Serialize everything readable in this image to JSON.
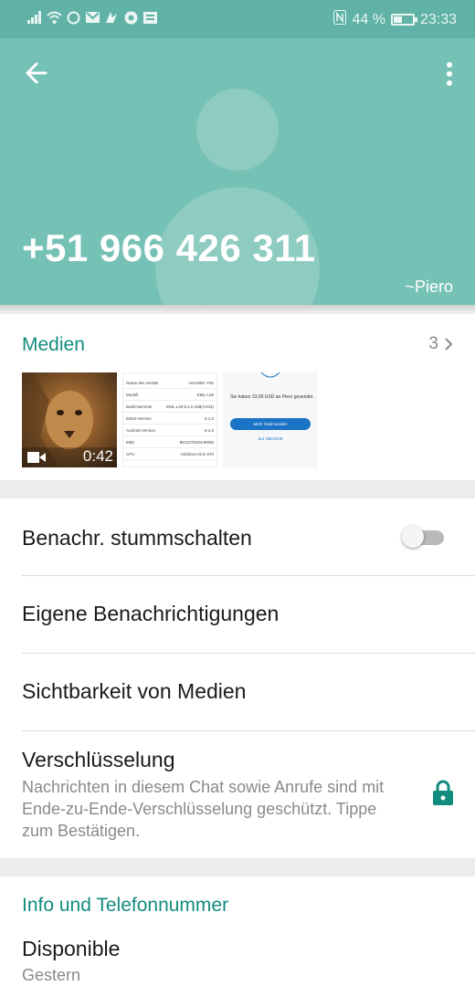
{
  "status_bar": {
    "battery_percent": "44 %",
    "battery_level": 0.44,
    "time": "23:33",
    "icons": [
      "signal-icon",
      "wifi-icon",
      "whatsapp-icon",
      "gmail-icon",
      "messenger-icon",
      "chrome-icon",
      "news-icon",
      "nfc-icon",
      "battery-icon"
    ]
  },
  "header": {
    "phone": "+51 966 426 311",
    "nickname": "~Piero",
    "background_color": "#76c1b6"
  },
  "media": {
    "title": "Medien",
    "count": "3",
    "video_duration": "0:42",
    "spec_rows": [
      {
        "k": "Name des Geräts",
        "v": "HUAWEI Y9S"
      },
      {
        "k": "Modell",
        "v": "EML-L29"
      },
      {
        "k": "Build-Nummer",
        "v": "EML-L29 8.1.0.168(C432)"
      },
      {
        "k": "EMUI-Version",
        "v": "8.1.0"
      },
      {
        "k": "Android-Version",
        "v": "8.1.0"
      },
      {
        "k": "IMEI",
        "v": "861107040449095"
      },
      {
        "k": "CPU",
        "v": "HiSilicon Kirin 970"
      }
    ],
    "payment": {
      "text": "Sie haben 33,00 USD an Piero gesendet.",
      "button": "Mehr Geld senden",
      "link": "Zur Übersicht"
    }
  },
  "settings": {
    "mute_label": "Benachr. stummschalten",
    "mute_on": false,
    "custom_notifications_label": "Eigene Benachrichtigungen",
    "media_visibility_label": "Sichtbarkeit von Medien",
    "encryption_label": "Verschlüsselung",
    "encryption_desc": "Nachrichten in diesem Chat sowie Anrufe sind mit Ende-zu-Ende-Verschlüsselung geschützt. Tippe zum Bestätigen.",
    "accent_color": "#128c7e"
  },
  "info": {
    "title": "Info und Telefonnummer",
    "about": "Disponible",
    "about_date": "Gestern"
  }
}
